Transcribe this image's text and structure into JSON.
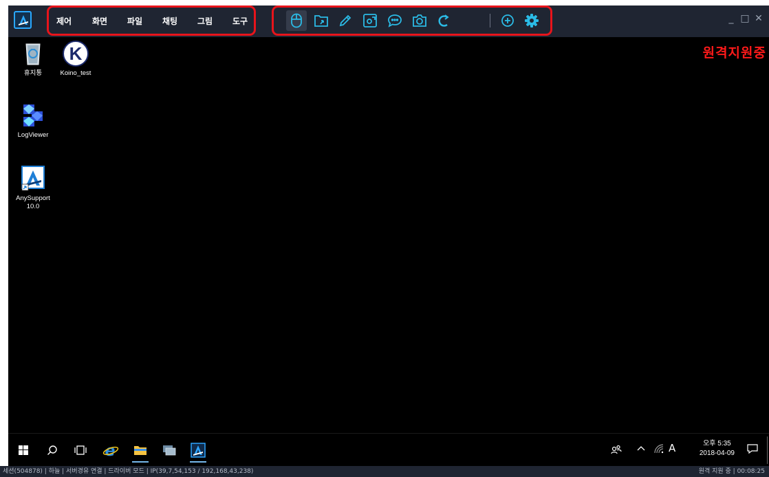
{
  "menu": {
    "items": [
      "제어",
      "화면",
      "파일",
      "채팅",
      "그림",
      "도구"
    ]
  },
  "toolbar": {
    "icons": [
      "mouse-icon",
      "file-transfer-icon",
      "pen-icon",
      "screen-record-icon",
      "chat-bubble-icon",
      "camera-icon",
      "refresh-icon",
      "add-circle-icon",
      "settings-gear-icon"
    ]
  },
  "window": {
    "minimize": "_",
    "maximize": "□",
    "close": "✕"
  },
  "desktop": {
    "status": "원격지원중",
    "icons": [
      {
        "label": "휴지통",
        "icon": "recycle-bin-icon"
      },
      {
        "label": "Koino_test",
        "icon": "koino-k-icon"
      },
      {
        "label": "LogViewer",
        "icon": "logviewer-icon"
      },
      {
        "label": "AnySupport 10.0",
        "icon": "anysupport-icon"
      }
    ]
  },
  "taskbar": {
    "clock_time": "오후 5:35",
    "clock_date": "2018-04-09",
    "ime": "A"
  },
  "statusbar": {
    "left": "세션(504878) | 하늘 | 서버경유 연결 | 드라이버 모드 | IP(39,7,54,153 / 192,168,43,238)",
    "right": "원격 지원 중 | 00:08:25"
  },
  "colors": {
    "titlebar": "#1f2532",
    "accent": "#29b5e8",
    "highlight_red": "#e8141b",
    "remote_status": "#ff1a1a"
  }
}
